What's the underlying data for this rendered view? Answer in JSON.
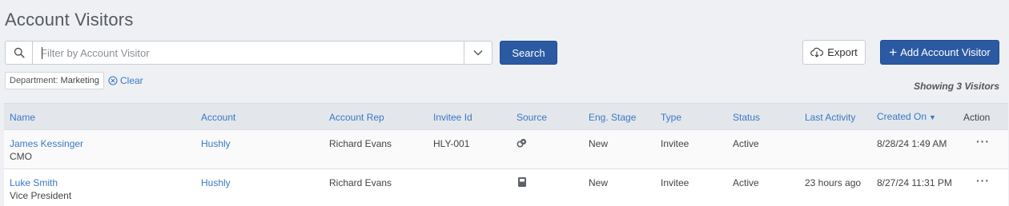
{
  "page_title": "Account Visitors",
  "search": {
    "placeholder": "Filter by Account Visitor",
    "value": "",
    "button_label": "Search"
  },
  "toolbar": {
    "export_label": "Export",
    "add_label": "Add Account Visitor"
  },
  "filter": {
    "key": "Department:",
    "value": "Marketing",
    "clear_label": "Clear"
  },
  "showing_text": "Showing 3 Visitors",
  "table": {
    "columns": [
      "Name",
      "Account",
      "Account Rep",
      "Invitee Id",
      "Source",
      "Eng. Stage",
      "Type",
      "Status",
      "Last Activity",
      "Created On",
      "Action"
    ],
    "sort_column": "Created On",
    "sort_direction": "desc",
    "rows": [
      {
        "name": "James Kessinger",
        "title": "CMO",
        "account": "Hushly",
        "account_rep": "Richard Evans",
        "invitee_id": "HLY-001",
        "source_icon": "integration-icon",
        "eng_stage": "New",
        "type": "Invitee",
        "status": "Active",
        "last_activity": "",
        "created_on": "8/28/24 1:49 AM"
      },
      {
        "name": "Luke Smith",
        "title": "Vice President",
        "account": "Hushly",
        "account_rep": "Richard Evans",
        "invitee_id": "",
        "source_icon": "form-icon",
        "eng_stage": "New",
        "type": "Invitee",
        "status": "Active",
        "last_activity": "23 hours ago",
        "created_on": "8/27/24 11:31 PM"
      }
    ]
  },
  "colors": {
    "accent": "#2b5aa3",
    "link": "#3a78c3",
    "background": "#eef0f4"
  }
}
